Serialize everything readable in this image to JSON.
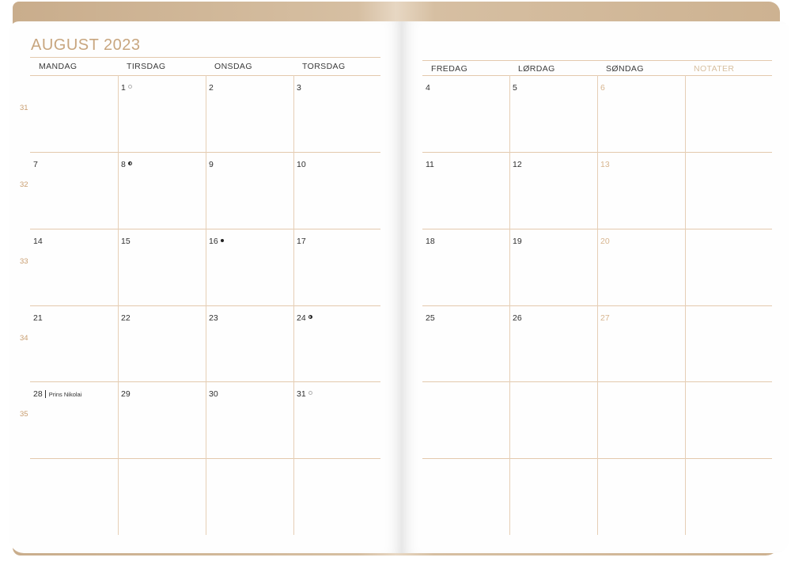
{
  "title": "AUGUST 2023",
  "left_headers": [
    "MANDAG",
    "TIRSDAG",
    "ONSDAG",
    "TORSDAG"
  ],
  "right_headers": [
    "FREDAG",
    "LØRDAG",
    "SØNDAG",
    "NOTATER"
  ],
  "week_numbers": [
    "31",
    "32",
    "33",
    "34",
    "35"
  ],
  "left_weeks": [
    [
      {
        "num": ""
      },
      {
        "num": "1",
        "moon": "full"
      },
      {
        "num": "2"
      },
      {
        "num": "3"
      }
    ],
    [
      {
        "num": "7"
      },
      {
        "num": "8",
        "moon": "last"
      },
      {
        "num": "9"
      },
      {
        "num": "10"
      }
    ],
    [
      {
        "num": "14"
      },
      {
        "num": "15"
      },
      {
        "num": "16",
        "moon": "new"
      },
      {
        "num": "17"
      }
    ],
    [
      {
        "num": "21"
      },
      {
        "num": "22"
      },
      {
        "num": "23"
      },
      {
        "num": "24",
        "moon": "first"
      }
    ],
    [
      {
        "num": "28",
        "holiday": "Prins Nikolai"
      },
      {
        "num": "29"
      },
      {
        "num": "30"
      },
      {
        "num": "31",
        "moon": "full"
      }
    ]
  ],
  "right_weeks": [
    [
      {
        "num": "4"
      },
      {
        "num": "5"
      },
      {
        "num": "6",
        "sunday": true
      }
    ],
    [
      {
        "num": "11"
      },
      {
        "num": "12"
      },
      {
        "num": "13",
        "sunday": true
      }
    ],
    [
      {
        "num": "18"
      },
      {
        "num": "19"
      },
      {
        "num": "20",
        "sunday": true
      }
    ],
    [
      {
        "num": "25"
      },
      {
        "num": "26"
      },
      {
        "num": "27",
        "sunday": true
      }
    ],
    [
      {
        "num": ""
      },
      {
        "num": ""
      },
      {
        "num": ""
      }
    ]
  ],
  "colors": {
    "accent": "#c8a67f",
    "grid": "#e3c9ad",
    "cover": "#d6bfa2"
  }
}
